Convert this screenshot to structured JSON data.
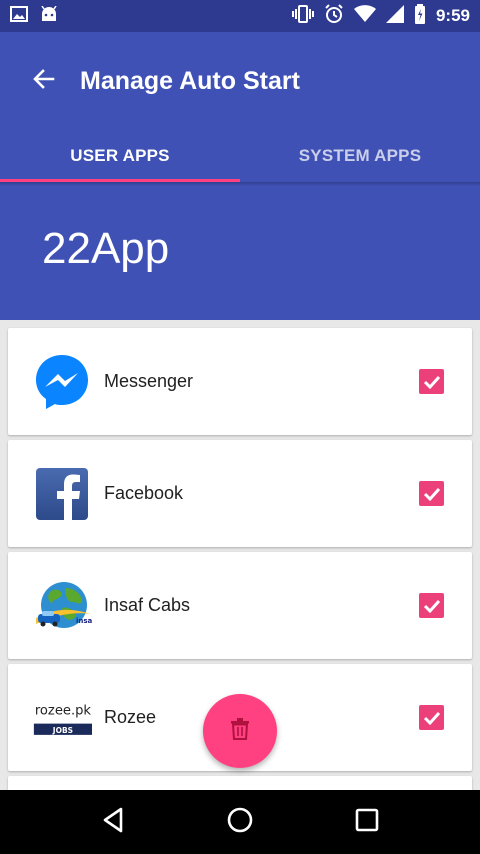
{
  "status_bar": {
    "time": "9:59",
    "left_icons": [
      "image-icon",
      "android-icon"
    ],
    "right_icons": [
      "vibrate-icon",
      "alarm-icon",
      "wifi-icon",
      "signal-icon",
      "battery-icon"
    ]
  },
  "toolbar": {
    "title": "Manage Auto Start",
    "back_icon": "arrow-back-icon"
  },
  "tabs": [
    {
      "label": "USER APPS",
      "active": true
    },
    {
      "label": "SYSTEM APPS",
      "active": false
    }
  ],
  "header": {
    "title": "22App"
  },
  "apps": [
    {
      "name": "Messenger",
      "icon": "messenger-icon",
      "checked": true
    },
    {
      "name": "Facebook",
      "icon": "facebook-icon",
      "checked": true
    },
    {
      "name": "Insaf Cabs",
      "icon": "insaf-cabs-icon",
      "checked": true,
      "icon_text": "insaf"
    },
    {
      "name": "Rozee",
      "icon": "rozee-icon",
      "checked": true,
      "icon_text": "rozee.pk",
      "icon_subtext": "JOBS"
    }
  ],
  "fab": {
    "icon": "delete-icon"
  },
  "nav_bar": {
    "icons": [
      "back-triangle-icon",
      "home-circle-icon",
      "recents-square-icon"
    ]
  },
  "colors": {
    "primary": "#3f51b5",
    "primary_dark": "#2e3a8f",
    "accent": "#ff4081",
    "checkbox": "#ec407a"
  }
}
